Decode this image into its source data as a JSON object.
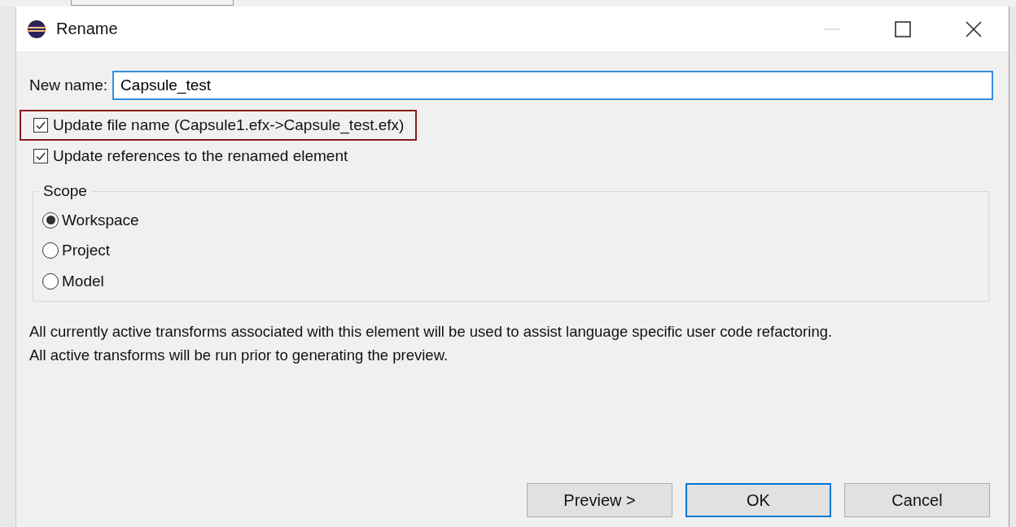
{
  "window": {
    "title": "Rename",
    "minimize_disabled": true
  },
  "new_name": {
    "label": "New name:",
    "value": "Capsule_test",
    "focused": true
  },
  "options": [
    {
      "label": "Update file name (Capsule1.efx->Capsule_test.efx)",
      "checked": true,
      "highlighted": true
    },
    {
      "label": "Update references to the renamed element",
      "checked": true,
      "highlighted": false
    }
  ],
  "scope": {
    "title": "Scope",
    "options": [
      {
        "label": "Workspace",
        "selected": true
      },
      {
        "label": "Project",
        "selected": false
      },
      {
        "label": "Model",
        "selected": false
      }
    ]
  },
  "description": [
    "All currently active transforms associated with this element will be used to assist language specific user code refactoring.",
    "All active transforms will be run prior to generating the preview."
  ],
  "buttons": [
    {
      "label": "Preview >",
      "default": false
    },
    {
      "label": "OK",
      "default": true
    },
    {
      "label": "Cancel",
      "default": false
    }
  ]
}
